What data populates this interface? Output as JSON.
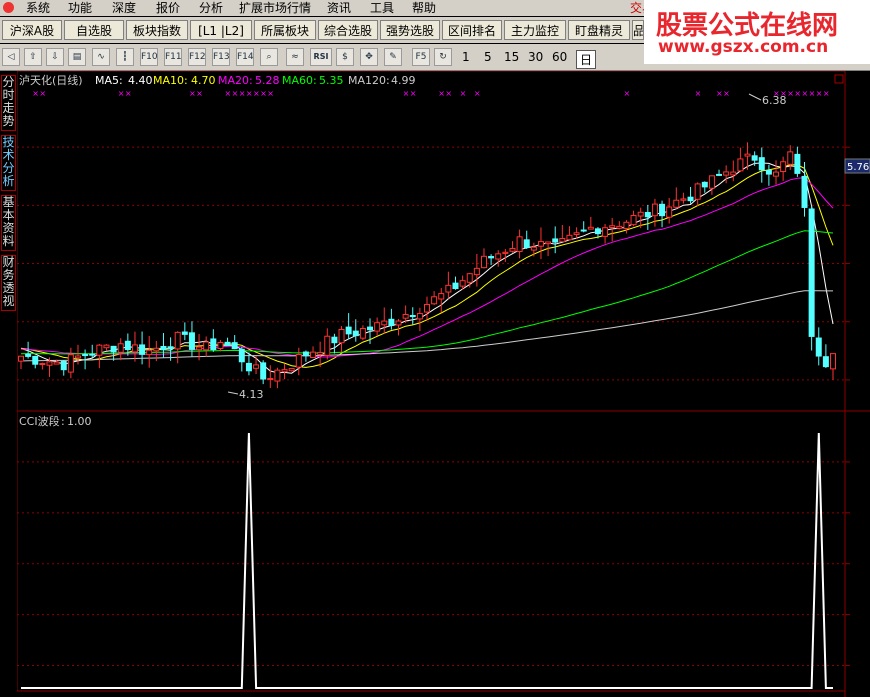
{
  "menu": [
    "系统",
    "功能",
    "深度",
    "报价",
    "分析",
    "扩展市场行情",
    "资讯",
    "工具",
    "帮助",
    "交易"
  ],
  "tabs": [
    {
      "label": "沪深A股"
    },
    {
      "label": "自选股"
    },
    {
      "label": "板块指数"
    },
    {
      "label": "[L1 |L2]"
    },
    {
      "label": "所属板块"
    },
    {
      "label": "综合选股"
    },
    {
      "label": "强势选股"
    },
    {
      "label": "区间排名"
    },
    {
      "label": "主力监控"
    },
    {
      "label": "盯盘精灵"
    },
    {
      "label": "品"
    }
  ],
  "toolbar": {
    "buttons": [
      "back-icon",
      "up-arrow-icon",
      "down-arrow-icon",
      "list-icon",
      "line-chart-icon",
      "candle-icon",
      "f10-icon",
      "f11-icon",
      "f12-icon",
      "f13-icon",
      "f14-icon",
      "zoom-icon",
      "indicator-icon",
      "rsi-icon",
      "dollar-icon",
      "move-icon",
      "pencil-icon",
      "f5-icon",
      "refresh-icon"
    ],
    "button_labels": [
      "◁",
      "⇧",
      "⇩",
      "▤",
      "∿",
      "┇",
      "F10",
      "F11",
      "F12",
      "F13",
      "F14",
      "⌕",
      "≈",
      "RSI",
      "$",
      "✥",
      "✎",
      "F5",
      "↻"
    ],
    "periods": [
      "1",
      "5",
      "15",
      "30",
      "60",
      "日"
    ]
  },
  "watermark": {
    "line1": "股票公式在线网",
    "line2": "www.gszx.com.cn"
  },
  "sidebar": [
    {
      "label": "分时走势",
      "active": false
    },
    {
      "label": "技术分析",
      "active": true
    },
    {
      "label": "基本资料",
      "active": false
    },
    {
      "label": "财务透视",
      "active": false
    }
  ],
  "colors": {
    "up": "#ff3232",
    "down": "#54ffff",
    "ma5": "#ffffff",
    "ma10": "#ffff00",
    "ma20": "#ff00ff",
    "ma60": "#00ff00",
    "ma120": "#cccccc",
    "grid": "#8b0000",
    "cci": "#ffffff",
    "signal": "#ff00ff"
  },
  "main_chart": {
    "stock_name": "泸天化(日线)",
    "ma": [
      {
        "label": "MA5:",
        "value": "4.40"
      },
      {
        "label": "MA10:",
        "value": "4.70"
      },
      {
        "label": "MA20:",
        "value": "5.28"
      },
      {
        "label": "MA60:",
        "value": "5.35"
      },
      {
        "label": "MA120:",
        "value": "4.99"
      }
    ],
    "high_label": "6.38",
    "low_label": "4.13",
    "price_tag": "5.76",
    "y_range": [
      3.95,
      6.55
    ]
  },
  "sub_chart": {
    "title": "CCI波段",
    "value": "1.00"
  },
  "chart_data": {
    "type": "candlestick",
    "x_count": 115,
    "ohlc_anchors": [
      [
        0,
        4.38
      ],
      [
        6,
        4.32
      ],
      [
        10,
        4.42
      ],
      [
        14,
        4.48
      ],
      [
        18,
        4.42
      ],
      [
        22,
        4.52
      ],
      [
        26,
        4.44
      ],
      [
        28,
        4.5
      ],
      [
        30,
        4.42
      ],
      [
        32,
        4.3
      ],
      [
        34,
        4.2
      ],
      [
        36,
        4.26
      ],
      [
        38,
        4.32
      ],
      [
        40,
        4.4
      ],
      [
        45,
        4.55
      ],
      [
        50,
        4.62
      ],
      [
        55,
        4.75
      ],
      [
        60,
        4.9
      ],
      [
        65,
        5.15
      ],
      [
        70,
        5.32
      ],
      [
        75,
        5.25
      ],
      [
        80,
        5.42
      ],
      [
        85,
        5.48
      ],
      [
        90,
        5.58
      ],
      [
        95,
        5.72
      ],
      [
        100,
        5.92
      ],
      [
        103,
        6.0
      ],
      [
        106,
        5.85
      ],
      [
        108,
        6.02
      ],
      [
        110,
        5.62
      ],
      [
        111,
        4.5
      ],
      [
        112,
        4.42
      ],
      [
        113,
        4.35
      ],
      [
        114,
        4.45
      ]
    ],
    "ma_labels": [
      "MA5",
      "MA10",
      "MA20",
      "MA60",
      "MA120"
    ],
    "cci_signal_indices": [
      32,
      112
    ],
    "signal_marker_indices": [
      2,
      3,
      14,
      15,
      24,
      25,
      29,
      30,
      31,
      32,
      33,
      34,
      35,
      54,
      55,
      59,
      60,
      62,
      64,
      85,
      95,
      98,
      99,
      106,
      107,
      108,
      109,
      110,
      111,
      112,
      113
    ]
  }
}
